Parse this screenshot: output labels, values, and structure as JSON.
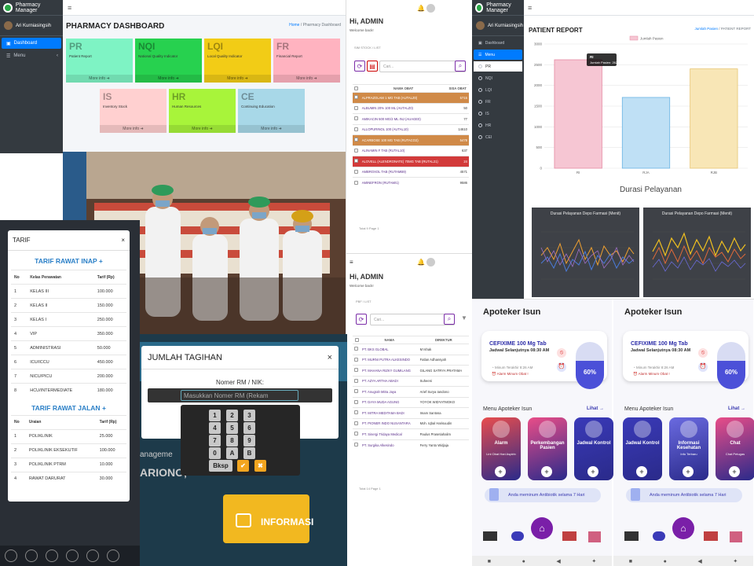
{
  "dashboard": {
    "brand": "Pharmacy Manager",
    "user": "Ari Kurniasingsih",
    "nav": [
      "Dashboard",
      "Menu"
    ],
    "title": "PHARMACY DASHBOARD",
    "crumb_home": "Home",
    "crumb_current": "Pharmacy Dashboard",
    "more_info": "More info",
    "boxes": [
      {
        "key": "PR",
        "name": "Patient Report",
        "color": "#7ef3c4"
      },
      {
        "key": "NQI",
        "name": "National Quality Indicator",
        "color": "#27d14f"
      },
      {
        "key": "LQI",
        "name": "Local Quality Indicator",
        "color": "#f2cc16"
      },
      {
        "key": "FR",
        "name": "Financial Report",
        "color": "#ffb3c0"
      },
      {
        "key": "IS",
        "name": "Inventory Stock",
        "color": "#ffd0d0"
      },
      {
        "key": "HR",
        "name": "Human Resources",
        "color": "#a8f43a"
      },
      {
        "key": "CE",
        "name": "Continuing Education",
        "color": "#a8d8e8"
      }
    ]
  },
  "obat": {
    "greeting": "Hi, ADMIN",
    "welcome": "Welcome back!",
    "section": "SIM STOCK / LIST",
    "search_placeholder": "Cari...",
    "headers": [
      "NAMA OBAT",
      "SISA OBAT"
    ],
    "rows": [
      {
        "name": "ALPRAZOLAM 1 MG TAB (AUTALZ0)",
        "qty": "5715",
        "style": "orange"
      },
      {
        "name": "ALBUMIN 20% 100 ML (AUTALZ0)",
        "qty": "50",
        "style": ""
      },
      {
        "name": "AMIKACIN 500 MG/2 ML INJ (AUAGE0)",
        "qty": "77",
        "style": ""
      },
      {
        "name": "ALLOPURINOL 100 (AUTAL10)",
        "qty": "14610",
        "style": ""
      },
      {
        "name": "ACARBOSE 100 MG TAB (RUTACO2)",
        "qty": "5478",
        "style": "orange"
      },
      {
        "name": "ALINAMIN F TAB (RUTAL10)",
        "qty": "637",
        "style": ""
      },
      {
        "name": "ALOVELL (ALENDRONATE) 70MG TAB (RUTAL21)",
        "qty": "24",
        "style": "red"
      },
      {
        "name": "AMBROXOL TAB (RUTAMB9)",
        "qty": "4571",
        "style": ""
      },
      {
        "name": "AMINEFRON (RUTAMI1)",
        "qty": "9586",
        "style": ""
      }
    ],
    "footer": "Total 9 Page 1"
  },
  "direktur": {
    "greeting": "Hi, ADMIN",
    "welcome": "Welcome back!",
    "section": "PBF / LIST",
    "search_placeholder": "Cari...",
    "headers": [
      "NAMA",
      "DIREKTUR"
    ],
    "rows": [
      {
        "name": "PT. BKS GLOBAL",
        "dir": "M Ishak"
      },
      {
        "name": "PT. MURNI PUTRA ALKESINDO",
        "dir": "Fatlan Adhansyah"
      },
      {
        "name": "PT. MAHANA RIZKY GUMILANG",
        "dir": "GILANG SATRYA PRATAMA"
      },
      {
        "name": "PT. AZYA ARTHA ABADI",
        "dir": "Suheeni"
      },
      {
        "name": "PT. Anugrah Mitra Jaya",
        "dir": "Arief Surya Iandono"
      },
      {
        "name": "PT. DAYA MUDA AGUNG",
        "dir": "YOYOK WIDYATMOKO"
      },
      {
        "name": "PT. MITRA MEDITAMA BADI",
        "dir": "Imam Santosa"
      },
      {
        "name": "PT. PIONER INDO NUSANTARA",
        "dir": "Moh. Iqbal Harisuudin"
      },
      {
        "name": "PT. Sinergi Tridaya Medical",
        "dir": "Paulus Prasetiahalim"
      },
      {
        "name": "PT. Surgika Alkesindo",
        "dir": "Ferry Yanto Widjaja"
      }
    ],
    "footer": "Total 14 Page 1"
  },
  "report": {
    "brand": "Pharmacy Manager",
    "user": "Ari Kurniasingsih",
    "nav": [
      "Dashboard",
      "Menu",
      "PR",
      "NQI",
      "LQI",
      "FR",
      "IS",
      "HR",
      "CEI"
    ],
    "title": "PATIENT REPORT",
    "crumb_home": "Jumlah Pasien",
    "crumb_current": "PATIENT REPORT",
    "section_title": "Durasi Pelayanan",
    "mini_titles": [
      "Durasi Pelayanan Depo Farmasi (Menit)",
      "Durasi Pelayanan Depo Farmasi (Menit)"
    ]
  },
  "chart_data": [
    {
      "type": "bar",
      "categories": [
        "RI",
        "RJA",
        "RJB"
      ],
      "series": [
        {
          "name": "Jumlah Pasien",
          "values": [
            2620,
            1710,
            2400
          ]
        }
      ],
      "ylim": [
        0,
        3000
      ],
      "yticks": [
        "0",
        "500",
        "1000",
        "1500",
        "2000",
        "2500",
        "3000"
      ],
      "tooltip": {
        "title": "RI",
        "label": "Jumlah Pasien: 2620"
      },
      "colors": [
        "#f6c6d3",
        "#bfe0f5",
        "#f8e6b6"
      ],
      "edge_colors": [
        "#e58aa3",
        "#69b4e4",
        "#e8c673"
      ]
    }
  ],
  "tarif": {
    "title": "TARIF",
    "close": "×",
    "inap_title": "TARIF RAWAT INAP",
    "inap_headers": [
      "No",
      "Kelas Perawatan",
      "Tarif (Rp)"
    ],
    "inap_rows": [
      [
        "1",
        "KELAS III",
        "100.000"
      ],
      [
        "2",
        "KELAS II",
        "150.000"
      ],
      [
        "3",
        "KELAS I",
        "250.000"
      ],
      [
        "4",
        "VIP",
        "350.000"
      ],
      [
        "5",
        "ADMINISTRASI",
        "50.000"
      ],
      [
        "6",
        "ICU/ICCU",
        "450.000"
      ],
      [
        "7",
        "NICU/PICU",
        "200.000"
      ],
      [
        "8",
        "HCU/INTERMEDIATE",
        "180.000"
      ]
    ],
    "jalan_title": "TARIF RAWAT JALAN",
    "jalan_headers": [
      "No",
      "Uraian",
      "Tarif (Rp)"
    ],
    "jalan_rows": [
      [
        "1",
        "POLIKLINIK",
        "25.000"
      ],
      [
        "2",
        "POLIKLINIK EKSEKUTIF",
        "100.000"
      ],
      [
        "3",
        "POLIKLINIK PTRM",
        "10.000"
      ],
      [
        "4",
        "RAWAT DARURAT",
        "30.000"
      ]
    ]
  },
  "tagihan": {
    "title": "JUMLAH TAGIHAN",
    "close": "×",
    "label": "Nomer RM / NIK:",
    "placeholder": "Masukkan Nomer RM (Rekam",
    "keys": [
      "1",
      "2",
      "3",
      "4",
      "5",
      "6",
      "7",
      "8",
      "9",
      "0",
      "A",
      "B"
    ],
    "bksp": "Bksp",
    "bg_text": [
      "INFORMASI",
      "ARIONO,",
      "anageme"
    ]
  },
  "apoteker": [
    {
      "title": "Apoteker Isun",
      "drug": "CEFIXIME 100 Mg Tab",
      "schedule": "Jadwal Selanjutnya 08:30 AM",
      "last": "Minum Terakhir 8:26 AM",
      "alarm": "Alarm Minum Obat !",
      "percent": "60%",
      "menu_title": "Menu Apoteker Isun",
      "see_all": "Lihat →",
      "cards": [
        {
          "label": "Alarm",
          "sub": "Lini Obat Hari Aspirin",
          "color": "#e84d4d"
        },
        {
          "label": "Perkembangan Pasien",
          "sub": "",
          "color": "#e94d88"
        },
        {
          "label": "Jadwal Kontrol",
          "sub": "",
          "color": "#3a3ab8"
        }
      ],
      "banner": "Anda meminum Antibiotik selama 7 Hari"
    },
    {
      "title": "Apoteker Isun",
      "drug": "CEFIXIME 100 Mg Tab",
      "schedule": "Jadwal Selanjutnya 08:30 AM",
      "last": "Minum Terakhir 8:26 AM",
      "alarm": "Alarm Minum Obat !",
      "percent": "60%",
      "menu_title": "Menu Apoteker Isun",
      "see_all": "Lihat →",
      "cards": [
        {
          "label": "Jadwal Kontrol",
          "sub": "",
          "color": "#3a3ab8"
        },
        {
          "label": "Informasi Kesehatan",
          "sub": "Info Terbaru",
          "color": "#6a6ae0"
        },
        {
          "label": "Chat",
          "sub": "Chat Petugas",
          "color": "#e94d88"
        }
      ],
      "banner": "Anda meminum Antibiotik selama 7 Hari"
    }
  ]
}
